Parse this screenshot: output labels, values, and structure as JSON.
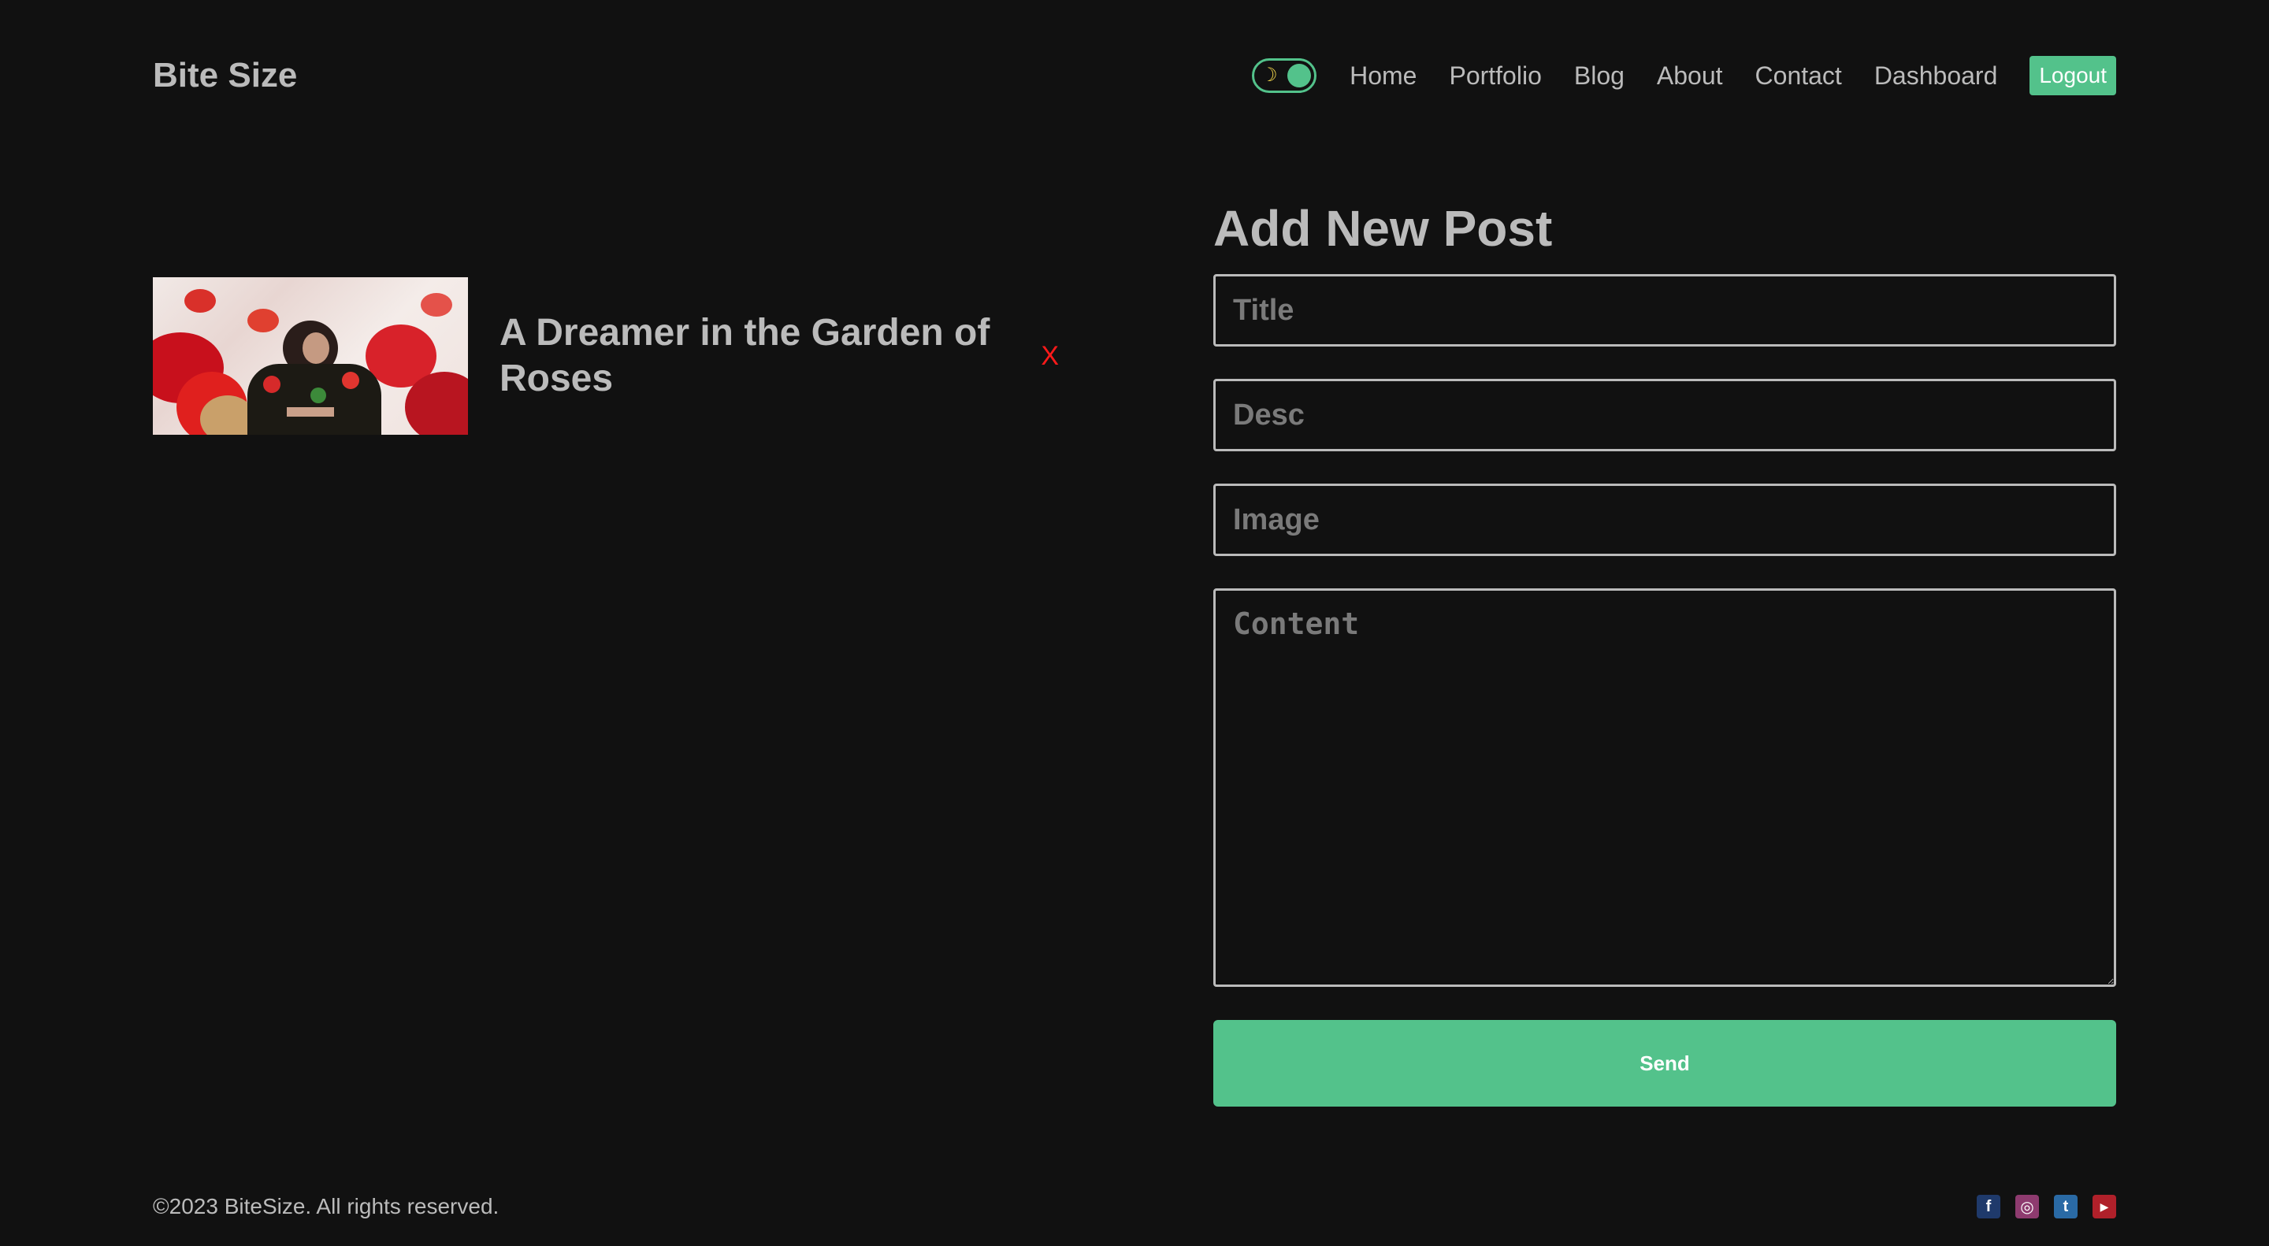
{
  "header": {
    "logo": "Bite Size",
    "theme_toggle": {
      "icon": "moon-icon",
      "moon_glyph": "☽"
    },
    "nav": [
      {
        "label": "Home"
      },
      {
        "label": "Portfolio"
      },
      {
        "label": "Blog"
      },
      {
        "label": "About"
      },
      {
        "label": "Contact"
      },
      {
        "label": "Dashboard"
      }
    ],
    "logout_label": "Logout"
  },
  "posts": [
    {
      "title": "A Dreamer in the Garden of Roses",
      "delete_label": "X"
    }
  ],
  "form": {
    "heading": "Add New Post",
    "title_placeholder": "Title",
    "desc_placeholder": "Desc",
    "image_placeholder": "Image",
    "content_placeholder": "Content",
    "send_label": "Send"
  },
  "footer": {
    "copyright": "©2023 BiteSize. All rights reserved.",
    "socials": [
      {
        "icon": "facebook-icon",
        "glyph": "f",
        "color": "#1f3a6b"
      },
      {
        "icon": "instagram-icon",
        "glyph": "◎",
        "color": "#8e3b6f"
      },
      {
        "icon": "twitter-icon",
        "glyph": "t",
        "color": "#2a6aa5"
      },
      {
        "icon": "youtube-icon",
        "glyph": "▶",
        "color": "#b0202a"
      }
    ]
  },
  "colors": {
    "background": "#111111",
    "accent": "#53c28b",
    "text": "#bbbbbb",
    "danger": "#ff1a1a"
  }
}
